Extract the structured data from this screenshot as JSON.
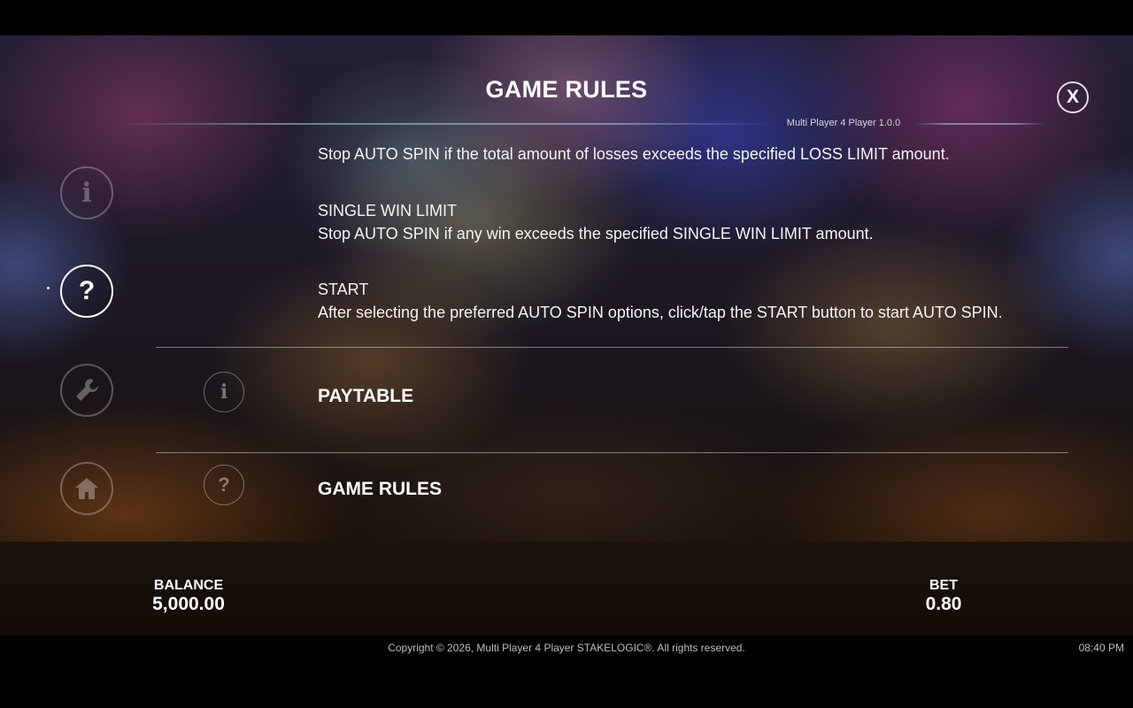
{
  "header": {
    "title": "GAME RULES",
    "version": "Multi Player 4 Player 1.0.0",
    "close_label": "X"
  },
  "side_nav": {
    "items": [
      {
        "name": "info",
        "glyph": "i",
        "active": false
      },
      {
        "name": "help",
        "glyph": "?",
        "active": true
      },
      {
        "name": "settings",
        "glyph": "wrench-icon",
        "active": false
      },
      {
        "name": "home",
        "glyph": "home-icon",
        "active": false
      }
    ]
  },
  "content": {
    "loss_limit_desc": "Stop AUTO SPIN if the total amount of losses exceeds the specified LOSS LIMIT amount.",
    "single_win_title": "SINGLE WIN LIMIT",
    "single_win_desc": "Stop AUTO SPIN if any win exceeds the specified SINGLE WIN LIMIT amount.",
    "start_title": "START",
    "start_desc": "After selecting the preferred AUTO SPIN options, click/tap the START button to start AUTO SPIN."
  },
  "menu": {
    "paytable": {
      "label": "PAYTABLE",
      "glyph": "i"
    },
    "game_rules": {
      "label": "GAME RULES",
      "glyph": "?"
    }
  },
  "footer": {
    "balance_label": "BALANCE",
    "balance_value": "5,000.00",
    "bet_label": "BET",
    "bet_value": "0.80",
    "copyright": "Copyright © 2026, Multi Player 4 Player STAKELOGIC®. All rights reserved.",
    "clock": "08:40 PM"
  },
  "colors": {
    "accent_line": "#aac8dc",
    "bar_bg": "#1c120b",
    "text": "#ffffff"
  }
}
